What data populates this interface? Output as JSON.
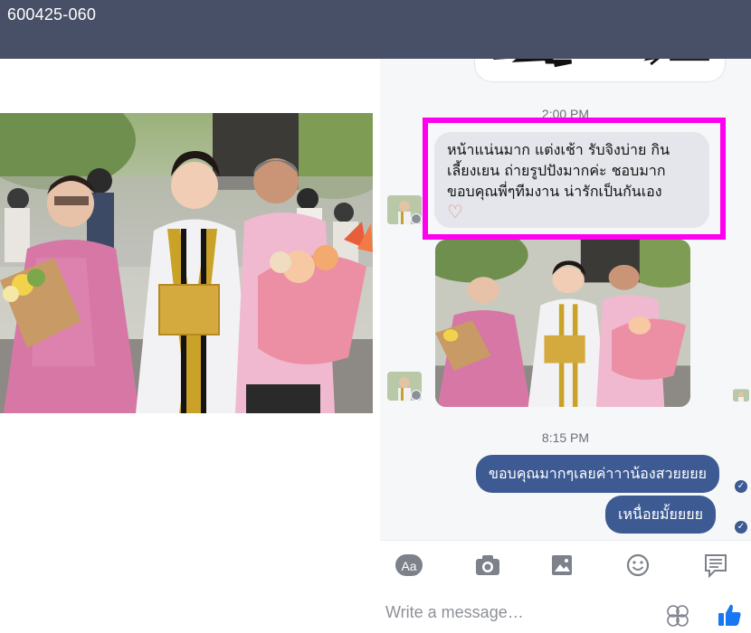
{
  "header": {
    "post_code": "600425-060"
  },
  "chat": {
    "time_1": "2:00 PM",
    "incoming_message": "หน้าแน่นมาก แต่งเช้า รับจิงบ่าย กินเลี้ยงเยน ถ่ายรูปปังมากค่ะ ชอบมาก ขอบคุณพี่ๆทีมงาน น่ารักเป็นกันเอง",
    "heart": "♡",
    "time_2": "8:15 PM",
    "outgoing_1": "ขอบคุณมากๆเลยค่าาาน้องสวยยยย",
    "outgoing_2": "เหนื่อยมั้ยยยย",
    "check": "✓"
  },
  "toolbar": {
    "aa_label": "Aa",
    "icons": [
      "text-format-icon",
      "camera-icon",
      "image-icon",
      "emoji-icon",
      "feedback-icon"
    ]
  },
  "composer": {
    "placeholder": "Write a message…"
  },
  "colors": {
    "header": "#475066",
    "highlight": "#ff00ee",
    "outgoing_bubble": "#3d5a93",
    "incoming_bubble": "#e4e6eb",
    "like": "#1877f2"
  }
}
